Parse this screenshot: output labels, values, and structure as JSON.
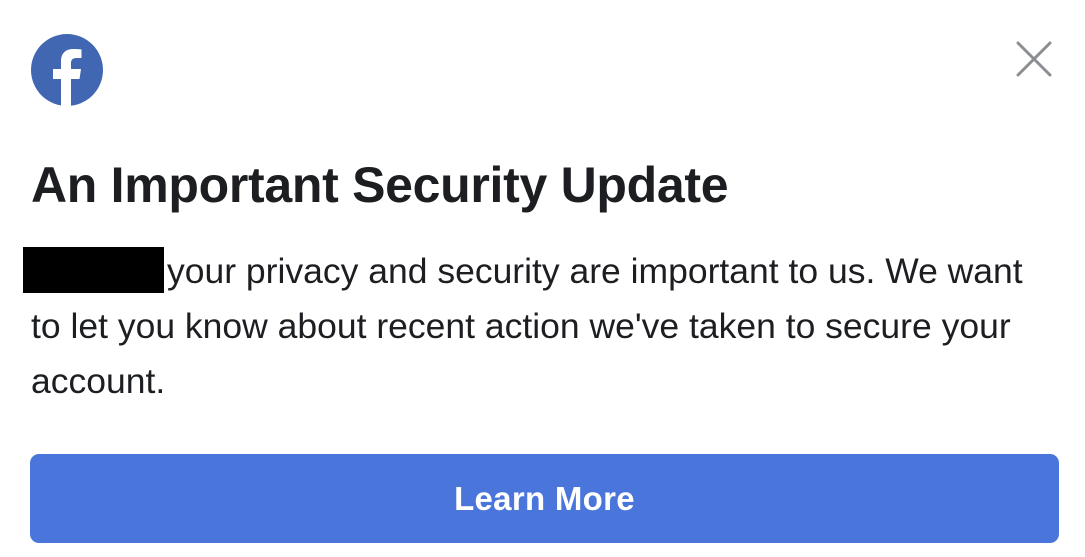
{
  "dialog": {
    "logo_icon": "facebook-logo-icon",
    "close_icon": "close-icon",
    "title": "An Important Security Update",
    "body_line_after_redaction": "your privacy and security are important to us. We want to let you know about recent action we've taken to secure your account.",
    "button_label": "Learn More"
  },
  "colors": {
    "facebook_blue": "#4267B2",
    "button_blue": "#4A76DC",
    "text": "#1C1E21",
    "close_icon": "#8A8D91",
    "redaction": "#000000"
  }
}
